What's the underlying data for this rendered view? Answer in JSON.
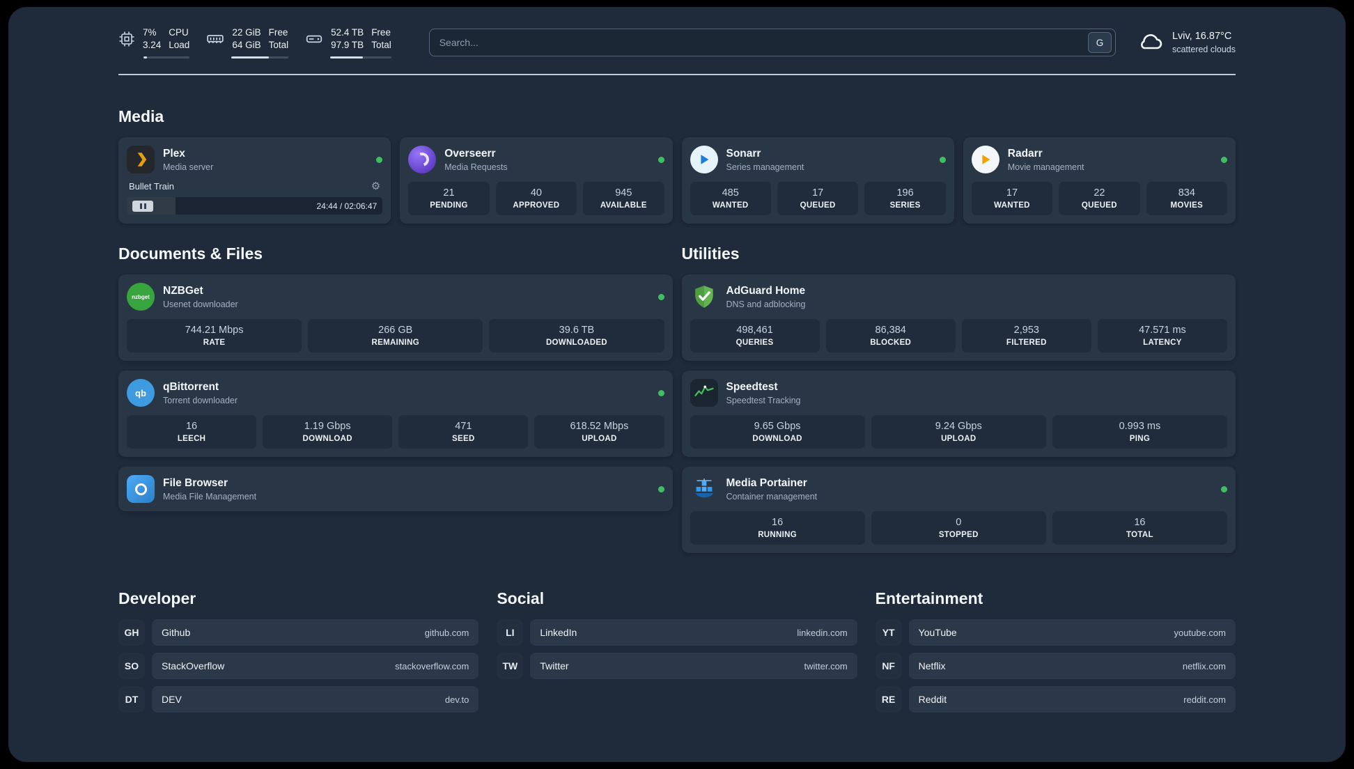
{
  "topbar": {
    "cpu": {
      "value_top": "7%",
      "value_bottom": "3.24",
      "label_top": "CPU",
      "label_bottom": "Load",
      "bar_percent": 7
    },
    "ram": {
      "value_top": "22 GiB",
      "value_bottom": "64 GiB",
      "label_top": "Free",
      "label_bottom": "Total",
      "bar_percent": 66
    },
    "disk": {
      "value_top": "52.4 TB",
      "value_bottom": "97.9 TB",
      "label_top": "Free",
      "label_bottom": "Total",
      "bar_percent": 54
    },
    "search": {
      "placeholder": "Search...",
      "button_label": "G"
    },
    "weather": {
      "location": "Lviv, 16.87°C",
      "condition": "scattered clouds"
    }
  },
  "sections": {
    "media": {
      "title": "Media",
      "cards": {
        "plex": {
          "name": "Plex",
          "subtitle": "Media server",
          "player": {
            "title": "Bullet Train",
            "time": "24:44 / 02:06:47",
            "progress_percent": 19
          }
        },
        "overseerr": {
          "name": "Overseerr",
          "subtitle": "Media Requests",
          "stats": [
            {
              "value": "21",
              "label": "PENDING"
            },
            {
              "value": "40",
              "label": "APPROVED"
            },
            {
              "value": "945",
              "label": "AVAILABLE"
            }
          ]
        },
        "sonarr": {
          "name": "Sonarr",
          "subtitle": "Series management",
          "stats": [
            {
              "value": "485",
              "label": "WANTED"
            },
            {
              "value": "17",
              "label": "QUEUED"
            },
            {
              "value": "196",
              "label": "SERIES"
            }
          ]
        },
        "radarr": {
          "name": "Radarr",
          "subtitle": "Movie management",
          "stats": [
            {
              "value": "17",
              "label": "WANTED"
            },
            {
              "value": "22",
              "label": "QUEUED"
            },
            {
              "value": "834",
              "label": "MOVIES"
            }
          ]
        }
      }
    },
    "documents": {
      "title": "Documents & Files",
      "cards": {
        "nzbget": {
          "name": "NZBGet",
          "subtitle": "Usenet downloader",
          "icon_text": "nzbget",
          "stats": [
            {
              "value": "744.21 Mbps",
              "label": "RATE"
            },
            {
              "value": "266 GB",
              "label": "REMAINING"
            },
            {
              "value": "39.6 TB",
              "label": "DOWNLOADED"
            }
          ]
        },
        "qbittorrent": {
          "name": "qBittorrent",
          "subtitle": "Torrent downloader",
          "icon_text": "qb",
          "stats": [
            {
              "value": "16",
              "label": "LEECH"
            },
            {
              "value": "1.19 Gbps",
              "label": "DOWNLOAD"
            },
            {
              "value": "471",
              "label": "SEED"
            },
            {
              "value": "618.52 Mbps",
              "label": "UPLOAD"
            }
          ]
        },
        "filebrowser": {
          "name": "File Browser",
          "subtitle": "Media File Management"
        }
      }
    },
    "utilities": {
      "title": "Utilities",
      "cards": {
        "adguard": {
          "name": "AdGuard Home",
          "subtitle": "DNS and adblocking",
          "stats": [
            {
              "value": "498,461",
              "label": "QUERIES"
            },
            {
              "value": "86,384",
              "label": "BLOCKED"
            },
            {
              "value": "2,953",
              "label": "FILTERED"
            },
            {
              "value": "47.571 ms",
              "label": "LATENCY"
            }
          ]
        },
        "speedtest": {
          "name": "Speedtest",
          "subtitle": "Speedtest Tracking",
          "stats": [
            {
              "value": "9.65 Gbps",
              "label": "DOWNLOAD"
            },
            {
              "value": "9.24 Gbps",
              "label": "UPLOAD"
            },
            {
              "value": "0.993 ms",
              "label": "PING"
            }
          ]
        },
        "portainer": {
          "name": "Media Portainer",
          "subtitle": "Container management",
          "stats": [
            {
              "value": "16",
              "label": "RUNNING"
            },
            {
              "value": "0",
              "label": "STOPPED"
            },
            {
              "value": "16",
              "label": "TOTAL"
            }
          ]
        }
      }
    },
    "bookmarks": [
      {
        "title": "Developer",
        "items": [
          {
            "abbr": "GH",
            "name": "Github",
            "url": "github.com"
          },
          {
            "abbr": "SO",
            "name": "StackOverflow",
            "url": "stackoverflow.com"
          },
          {
            "abbr": "DT",
            "name": "DEV",
            "url": "dev.to"
          }
        ]
      },
      {
        "title": "Social",
        "items": [
          {
            "abbr": "LI",
            "name": "LinkedIn",
            "url": "linkedin.com"
          },
          {
            "abbr": "TW",
            "name": "Twitter",
            "url": "twitter.com"
          }
        ]
      },
      {
        "title": "Entertainment",
        "items": [
          {
            "abbr": "YT",
            "name": "YouTube",
            "url": "youtube.com"
          },
          {
            "abbr": "NF",
            "name": "Netflix",
            "url": "netflix.com"
          },
          {
            "abbr": "RE",
            "name": "Reddit",
            "url": "reddit.com"
          }
        ]
      }
    ]
  }
}
